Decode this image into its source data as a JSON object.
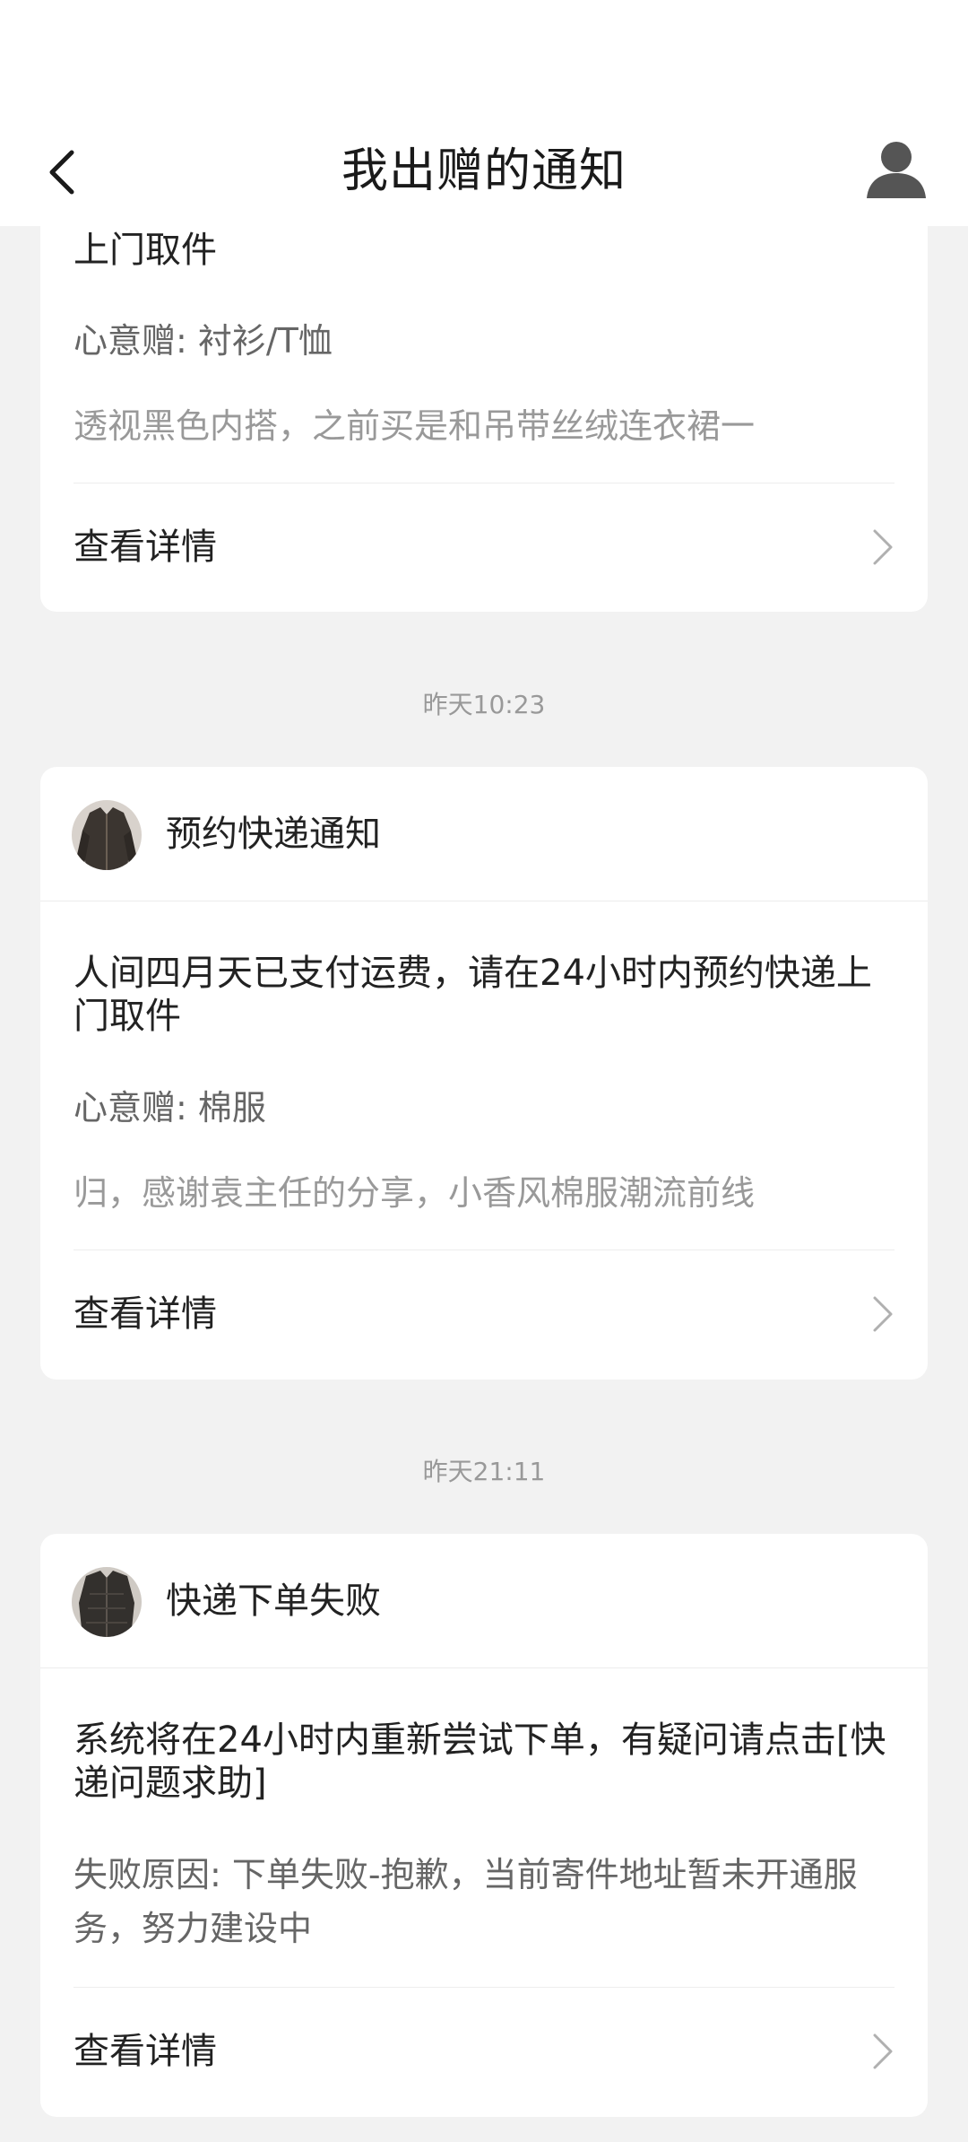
{
  "header": {
    "title": "我出赠的通知",
    "back_icon": "chevron-left-icon",
    "profile_icon": "user-icon"
  },
  "cards": [
    {
      "message_tail": "上门取件",
      "item_line": "心意赠: 衬衫/T恤",
      "description": "透视黑色内搭，之前买是和吊带丝绒连衣裙一",
      "detail_label": "查看详情"
    },
    {
      "timestamp": "昨天10:23",
      "title": "预约快递通知",
      "message": "人间四月天已支付运费，请在24小时内预约快递上门取件",
      "item_line": "心意赠: 棉服",
      "description": "归，感谢袁主任的分享，小香风棉服潮流前线",
      "detail_label": "查看详情"
    },
    {
      "timestamp": "昨天21:11",
      "title": "快递下单失败",
      "message": "系统将在24小时内重新尝试下单，有疑问请点击[快递问题求助]",
      "reason": "失败原因: 下单失败-抱歉，当前寄件地址暂未开通服务，努力建设中",
      "detail_label": "查看详情"
    }
  ],
  "colors": {
    "background": "#f2f2f2",
    "card": "#ffffff",
    "primary_text": "#222222",
    "secondary_text": "#666666",
    "muted_text": "#999999"
  }
}
